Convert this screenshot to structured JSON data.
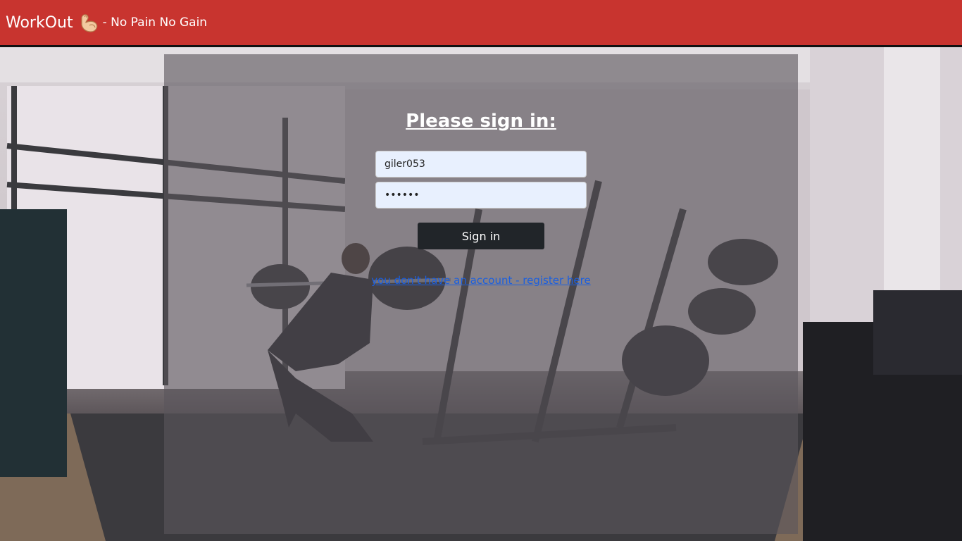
{
  "navbar": {
    "brand": "WorkOut",
    "brand_icon": "flexed-bicep-icon",
    "tagline": "- No Pain No Gain",
    "color": "#c8342f"
  },
  "login": {
    "title": "Please sign in:",
    "username_value": "giler053",
    "password_value": "123456",
    "sign_in_label": "Sign in",
    "register_link": "you don't have an account - register here"
  }
}
